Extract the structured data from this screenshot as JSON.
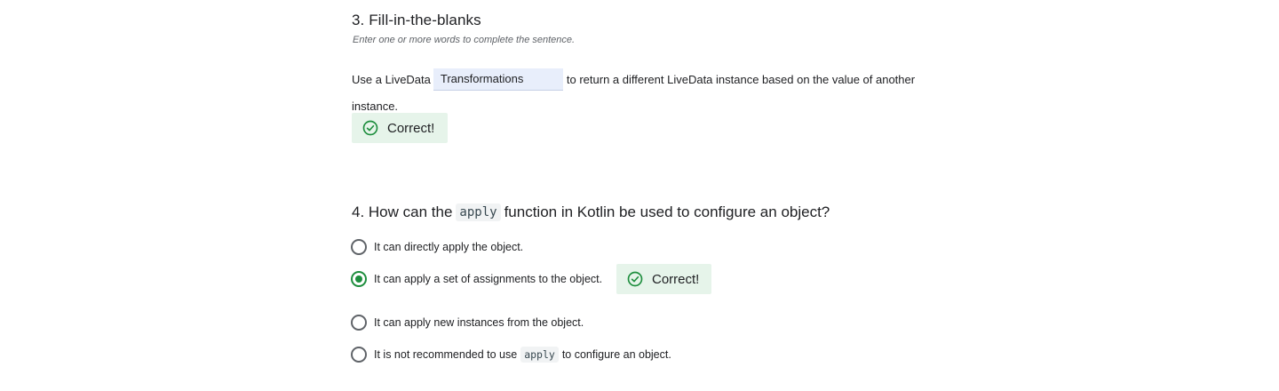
{
  "q3": {
    "title": "3. Fill-in-the-blanks",
    "instructions": "Enter one or more words to complete the sentence.",
    "sentence_before": "Use a LiveData",
    "answer_value": "Transformations",
    "sentence_after": "to return a different LiveData instance based on the value of another",
    "sentence_wrap": "instance.",
    "feedback": "Correct!"
  },
  "q4": {
    "title_prefix": "4. How can the",
    "title_code": "apply",
    "title_suffix": "function in Kotlin be used to configure an object?",
    "options": [
      {
        "label": "It can directly apply the object.",
        "selected": false
      },
      {
        "label": "It can apply a set of assignments to the object.",
        "selected": true
      },
      {
        "label": "It can apply new instances from the object.",
        "selected": false
      },
      {
        "label_prefix": "It is not recommended to use",
        "label_code": "apply",
        "label_suffix": "to configure an object.",
        "selected": false
      }
    ],
    "feedback": "Correct!"
  },
  "icons": {
    "check_circle": "check-circle-icon"
  },
  "colors": {
    "correct_green": "#1e8e3e",
    "correct_bg": "#e6f4ea",
    "input_bg": "#e8eefb"
  }
}
